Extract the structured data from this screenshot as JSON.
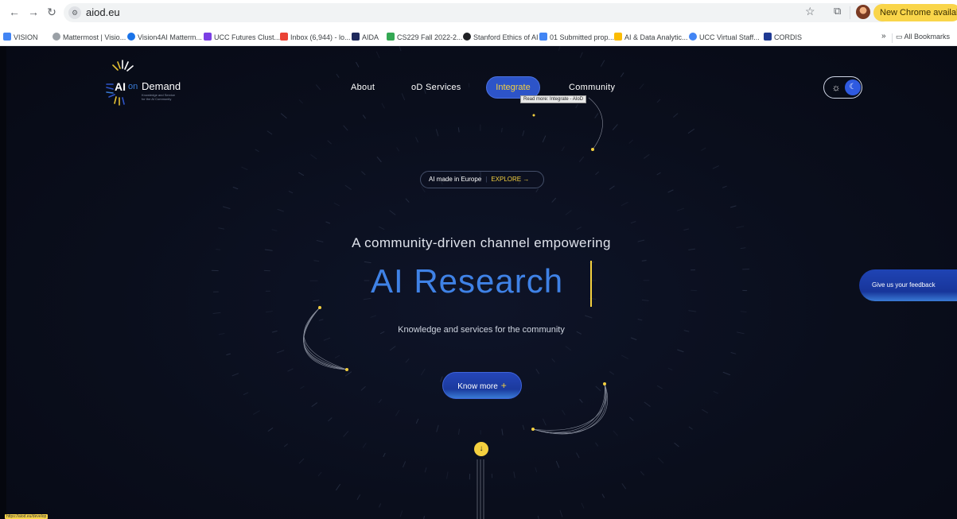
{
  "browser": {
    "url": "aiod.eu",
    "update_button": "New Chrome available",
    "bookmarks": [
      {
        "label": "VISION",
        "color": "#4285f4"
      },
      {
        "label": "Mattermost | Visio...",
        "color": "#9aa0a6"
      },
      {
        "label": "Vision4AI Matterm...",
        "color": "#1a73e8"
      },
      {
        "label": "UCC Futures Clust...",
        "color": "#7b3fe4"
      },
      {
        "label": "Inbox (6,944) - lo...",
        "color": "#ea4335"
      },
      {
        "label": "AIDA",
        "color": "#1f2a5c"
      },
      {
        "label": "CS229 Fall 2022-2...",
        "color": "#34a853"
      },
      {
        "label": "Stanford Ethics of AI",
        "color": "#202124"
      },
      {
        "label": "01 Submitted prop...",
        "color": "#4285f4"
      },
      {
        "label": "AI & Data Analytic...",
        "color": "#fbbc04"
      },
      {
        "label": "UCC Virtual Staff...",
        "color": "#4285f4"
      },
      {
        "label": "CORDIS",
        "color": "#1f3a93"
      }
    ],
    "more_bookmarks": "»",
    "all_bookmarks": "All Bookmarks",
    "status_url": "https://aiod.eu/develop"
  },
  "logo": {
    "ai": "AI",
    "on": "on",
    "demand": "Demand",
    "tagline_1": "Knowledge and Service",
    "tagline_2": "for the AI Community"
  },
  "nav": {
    "about": "About",
    "services": "oD Services",
    "integrate": "Integrate",
    "community": "Community",
    "tooltip": "Read more: Integrate - AIoD"
  },
  "hero": {
    "badge_text": "AI made in Europe",
    "badge_sep": "|",
    "badge_link": "EXPLORE →",
    "headline": "A community-driven channel empowering",
    "title": "AI Research",
    "subhead": "Knowledge and services for the community",
    "cta_label": "Know more",
    "cta_plus": "+"
  },
  "feedback_label": "Give us your feedback",
  "colors": {
    "accent_yellow": "#f4d03f",
    "brand_blue": "#2d54c8",
    "title_blue": "#3f82e6",
    "background": "#0b0f1e"
  }
}
